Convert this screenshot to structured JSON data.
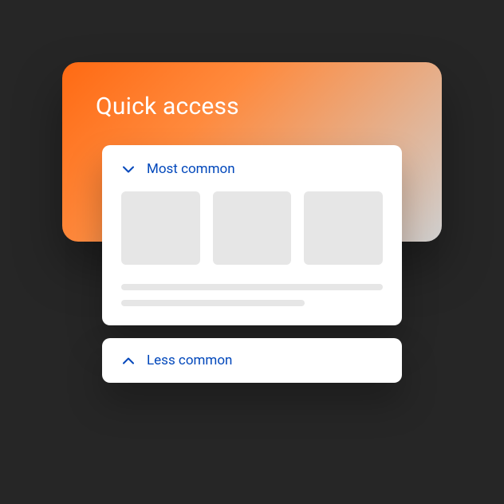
{
  "header": {
    "title": "Quick access"
  },
  "accordion": {
    "expanded": {
      "label": "Most common"
    },
    "collapsed": {
      "label": "Less common"
    }
  }
}
